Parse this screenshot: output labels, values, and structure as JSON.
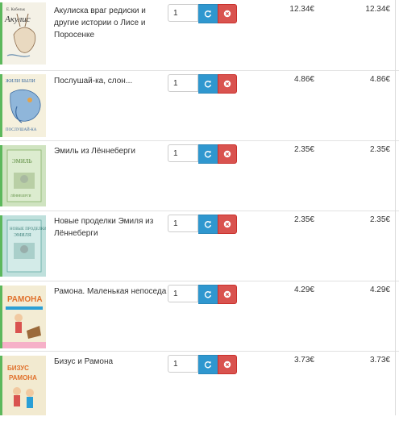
{
  "currency_symbol": "€",
  "rows": [
    {
      "title": "Акулиска враг редиски и другие истории о Лисе и Поросенке",
      "quantity": "1",
      "unit_price": "12.34€",
      "total_price": "12.34€",
      "cover": {
        "bg": "#f4f1e6",
        "accent": "#6a8fb0",
        "frame": "#5cb85c"
      }
    },
    {
      "title": "Послушай-ка, слон...",
      "quantity": "1",
      "unit_price": "4.86€",
      "total_price": "4.86€",
      "cover": {
        "bg": "#f5f0dd",
        "accent": "#7aa7cf",
        "frame": "#5cb85c"
      }
    },
    {
      "title": "Эмиль из Лённеберги",
      "quantity": "1",
      "unit_price": "2.35€",
      "total_price": "2.35€",
      "cover": {
        "bg": "#cfe3c0",
        "accent": "#86b26a",
        "frame": "#5cb85c"
      }
    },
    {
      "title": "Новые проделки Эмиля из Лённеберги",
      "quantity": "1",
      "unit_price": "2.35€",
      "total_price": "2.35€",
      "cover": {
        "bg": "#bfe0dc",
        "accent": "#5fa8a1",
        "frame": "#5cb85c"
      }
    },
    {
      "title": "Рамона. Маленькая непоседа",
      "quantity": "1",
      "unit_price": "4.29€",
      "total_price": "4.29€",
      "cover": {
        "bg": "#f3ecd4",
        "accent": "#e0712c",
        "frame": "#5cb85c"
      }
    },
    {
      "title": "Бизус и Рамона",
      "quantity": "1",
      "unit_price": "3.73€",
      "total_price": "3.73€",
      "cover": {
        "bg": "#f2ead0",
        "accent": "#e0712c",
        "frame": "#5cb85c"
      }
    }
  ],
  "colors": {
    "refresh": "#2f97cf",
    "remove": "#d9534f"
  },
  "icons": {
    "refresh": "refresh-icon",
    "remove": "remove-icon"
  }
}
